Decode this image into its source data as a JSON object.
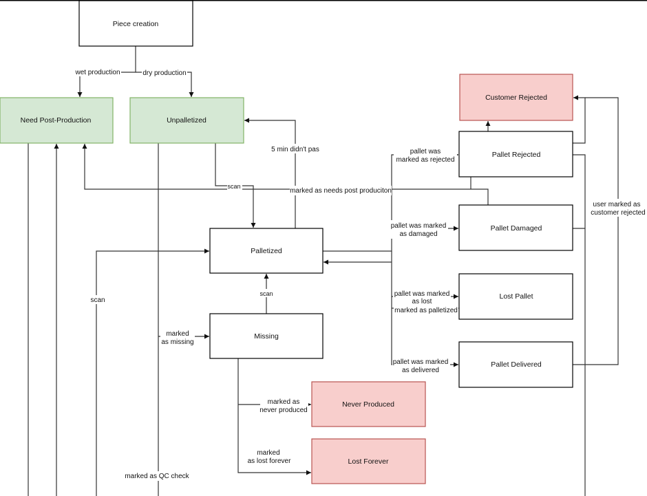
{
  "colors": {
    "success_state": "#d5e8d4",
    "terminal_state": "#f8cecc",
    "line": "#333333"
  },
  "nodes": {
    "piece_creation": "Piece creation",
    "need_post_production": "Need Post-Production",
    "unpalletized": "Unpalletized",
    "customer_rejected": "Customer Rejected",
    "pallet_rejected": "Pallet Rejected",
    "pallet_damaged": "Pallet Damaged",
    "palletized": "Palletized",
    "lost_pallet": "Lost Pallet",
    "missing": "Missing",
    "pallet_delivered": "Pallet Delivered",
    "never_produced": "Never Produced",
    "lost_forever": "Lost Forever"
  },
  "edges": {
    "wet_production": "wet production",
    "dry_production": "dry production",
    "five_min": "5 min didn't pas",
    "scan_unpalletized": "scan",
    "needs_post": "marked as needs post produciton",
    "rejected": [
      "pallet was",
      "marked as rejected"
    ],
    "damaged": [
      "pallet was marked",
      "as damaged"
    ],
    "lost": [
      "pallet was marked",
      "as lost"
    ],
    "marked_palletized": "marked as palletized",
    "delivered": [
      "pallet was marked",
      "as delivered"
    ],
    "scan_left": "scan",
    "scan_missing": "scan",
    "marked_missing": [
      "marked",
      "as missing"
    ],
    "never_produced": [
      "marked as",
      "never produced"
    ],
    "lost_forever": [
      "marked",
      "as lost forever"
    ],
    "qc_check": "marked as QC check",
    "customer_rejected": [
      "user marked as",
      "customer rejected"
    ]
  }
}
